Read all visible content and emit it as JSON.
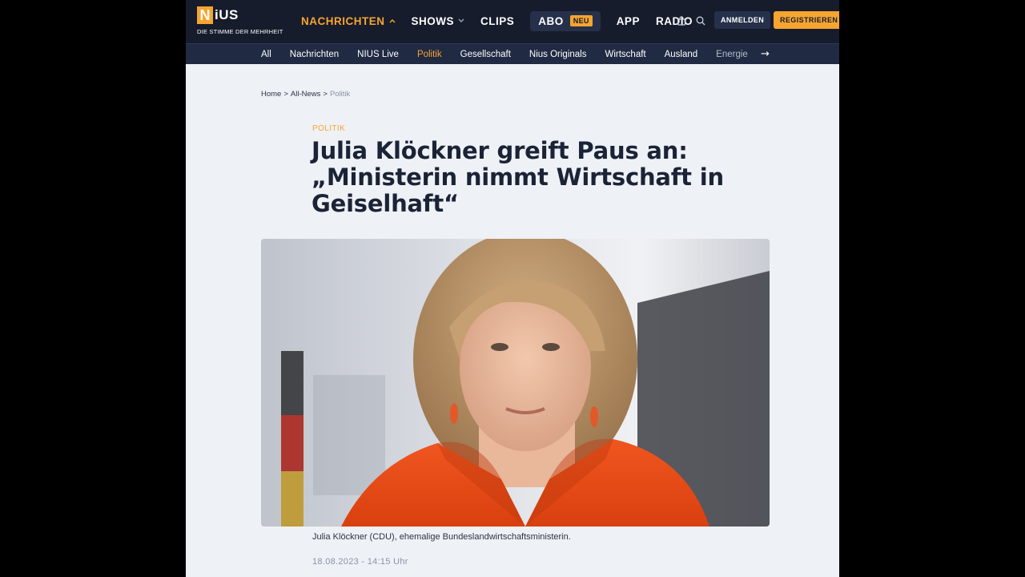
{
  "header": {
    "logo_word": "iUS",
    "logo_letter": "N",
    "tagline": "DIE STIMME DER MEHRHEIT",
    "nav": [
      {
        "label": "NACHRICHTEN",
        "active": true
      },
      {
        "label": "SHOWS"
      },
      {
        "label": "CLIPS"
      },
      {
        "label": "ABO",
        "badge": "NEU"
      },
      {
        "label": "APP"
      },
      {
        "label": "RADIO"
      }
    ],
    "login_label": "ANMELDEN",
    "register_label": "REGISTRIEREN"
  },
  "subnav": {
    "items": [
      "All",
      "Nachrichten",
      "NIUS Live",
      "Politik",
      "Gesellschaft",
      "Nius Originals",
      "Wirtschaft",
      "Ausland",
      "Energie"
    ],
    "active": "Politik",
    "arrow": "→"
  },
  "breadcrumb": [
    "Home",
    "All-News",
    "Politik"
  ],
  "article": {
    "kicker": "POLITIK",
    "headline": "Julia Klöckner greift Paus an: „Ministerin nimmt Wirtschaft in Geiselhaft“",
    "caption": "Julia Klöckner (CDU), ehemalige Bundeslandwirtschaftsministerin.",
    "date": "18.08.2023 - 14:15 Uhr"
  },
  "colors": {
    "accent": "#f7a530",
    "header_bg": "#161c2b",
    "subnav_bg": "#202a42",
    "page_bg": "#eef1f6",
    "headline": "#1b2336"
  }
}
